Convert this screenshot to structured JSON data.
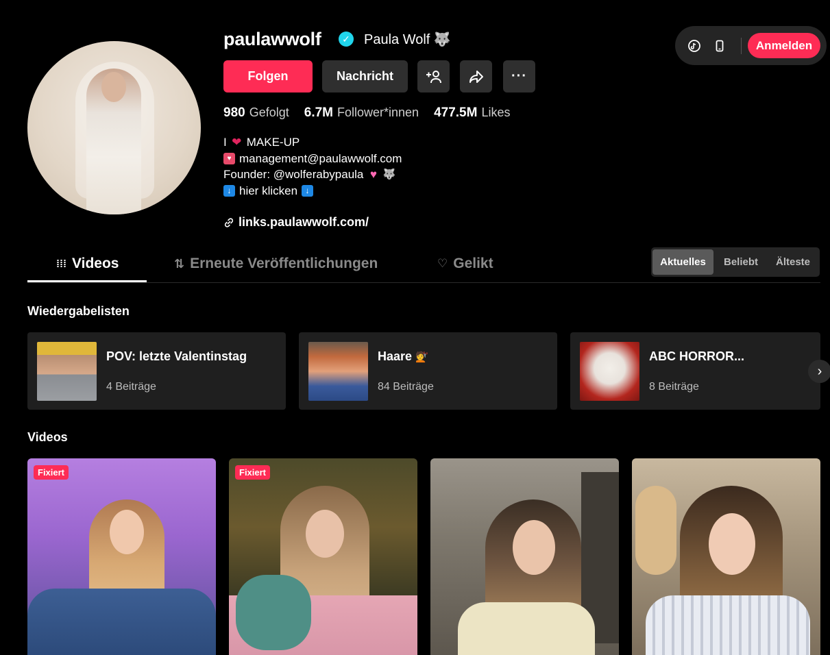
{
  "header": {
    "username": "paulawwolf",
    "nickname": "Paula Wolf",
    "nickname_emoji": "wolf-icon",
    "follow_label": "Folgen",
    "message_label": "Nachricht"
  },
  "topbar": {
    "login_label": "Anmelden"
  },
  "stats": [
    {
      "value": "980",
      "label": "Gefolgt"
    },
    {
      "value": "6.7M",
      "label": "Follower*innen"
    },
    {
      "value": "477.5M",
      "label": "Likes"
    }
  ],
  "bio": {
    "line1": "MAKE-UP",
    "line1_prefix": "I",
    "line2": "management@paulawwolf.com",
    "line3": "Founder: @wolferabypaula",
    "line4": "hier klicken"
  },
  "link": "links.paulawwolf.com/",
  "tabs": [
    {
      "label": "Videos"
    },
    {
      "label": "Erneute Veröffentlichungen"
    },
    {
      "label": "Gelikt"
    }
  ],
  "sort": [
    "Aktuelles",
    "Beliebt",
    "Älteste"
  ],
  "sections": {
    "playlists": "Wiedergabelisten",
    "videos": "Videos"
  },
  "playlists": [
    {
      "title": "POV: letzte Valentinstag",
      "count": "4 Beiträge"
    },
    {
      "title": "Haare",
      "count": "84 Beiträge"
    },
    {
      "title": "ABC HORROR...",
      "count": "8 Beiträge"
    }
  ],
  "videos": [
    {
      "badge": "Fixiert"
    },
    {
      "badge": "Fixiert"
    },
    {
      "badge": ""
    },
    {
      "badge": ""
    }
  ],
  "colors": {
    "accent": "#fe2c55",
    "verified": "#20d5ec",
    "background": "#000000",
    "surface": "#1f1f1f"
  }
}
